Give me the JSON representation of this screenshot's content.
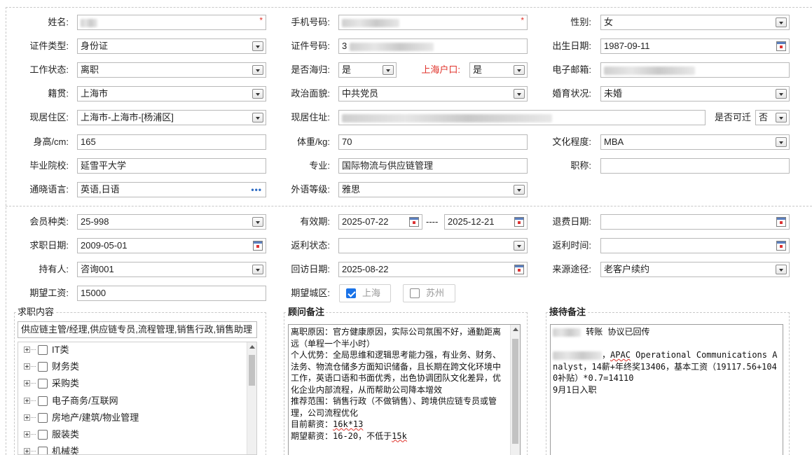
{
  "basic": {
    "name_label": "姓名:",
    "phone_label": "手机号码:",
    "gender_label": "性别:",
    "gender_value": "女",
    "id_type_label": "证件类型:",
    "id_type_value": "身份证",
    "id_no_label": "证件号码:",
    "id_no_prefix": "3",
    "birth_label": "出生日期:",
    "birth_value": "1987-09-11",
    "work_status_label": "工作状态:",
    "work_status_value": "离职",
    "returnee_label": "是否海归:",
    "returnee_value": "是",
    "sh_hukou_label": "上海户口:",
    "sh_hukou_value": "是",
    "email_label": "电子邮箱:",
    "native_label": "籍贯:",
    "native_value": "上海市",
    "political_label": "政治面貌:",
    "political_value": "中共党员",
    "marital_label": "婚育状况:",
    "marital_value": "未婚",
    "residence_area_label": "现居住区:",
    "residence_area_value": "上海市-上海市-[杨浦区]",
    "residence_addr_label": "现居住址:",
    "relocate_label": "是否可迁",
    "relocate_value": "否",
    "height_label": "身高/cm:",
    "height_value": "165",
    "weight_label": "体重/kg:",
    "weight_value": "70",
    "education_label": "文化程度:",
    "education_value": "MBA",
    "school_label": "毕业院校:",
    "school_value": "延雪平大学",
    "major_label": "专业:",
    "major_value": "国际物流与供应链管理",
    "title_label": "职称:",
    "lang_label": "通晓语言:",
    "lang_value": "英语,日语",
    "lang_more": "•••",
    "lang_level_label": "外语等级:",
    "lang_level_value": "雅思",
    "required_mark": "*"
  },
  "membership": {
    "member_type_label": "会员种类:",
    "member_type_value": "25-998",
    "valid_label": "有效期:",
    "valid_from": "2025-07-22",
    "valid_sep": "----",
    "valid_to": "2025-12-21",
    "refund_date_label": "退费日期:",
    "job_date_label": "求职日期:",
    "job_date_value": "2009-05-01",
    "rebate_status_label": "返利状态:",
    "rebate_time_label": "返利时间:",
    "holder_label": "持有人:",
    "holder_value": "咨询001",
    "revisit_label": "回访日期:",
    "revisit_value": "2025-08-22",
    "source_label": "来源途径:",
    "source_value": "老客户续约",
    "salary_label": "期望工资:",
    "salary_value": "15000",
    "city_label": "期望城区:",
    "city_options": [
      {
        "label": "上海",
        "checked": true
      },
      {
        "label": "苏州",
        "checked": false
      }
    ]
  },
  "job_content": {
    "title": "求职内容",
    "summary": "供应链主管/经理,供应链专员,流程管理,销售行政,销售助理",
    "tree": [
      "IT类",
      "财务类",
      "采购类",
      "电子商务/互联网",
      "房地产/建筑/物业管理",
      "服装类",
      "机械类"
    ]
  },
  "consultant_notes": {
    "title": "顾问备注",
    "lines": [
      "离职原因：官方健康原因，实际公司氛围不好，通勤距离远（单程一个半小时）",
      "个人优势：全局思维和逻辑思考能力强，有业务、财务、法务、物流仓储多方面知识储备，且长期在跨文化环境中工作，英语口语和书面优秀，出色协调团队文化差异，优化企业内部流程，从而帮助公司降本增效",
      "推荐范围：销售行政（不做销售）、跨境供应链专员或管理，公司流程优化",
      "目前薪资："
    ],
    "current_salary": "16k*13",
    "expected_prefix": "期望薪资：16-20，不低于",
    "expected_min": "15k"
  },
  "reception_notes": {
    "title": "接待备注",
    "line1": "转账 协议已回传",
    "apac": "APAC",
    "line2": " Operational Communications Analyst，14薪+年终奖13406，基本工资（19117.56+1040补贴）*0.7=14110",
    "line3": "9月1日入职"
  }
}
